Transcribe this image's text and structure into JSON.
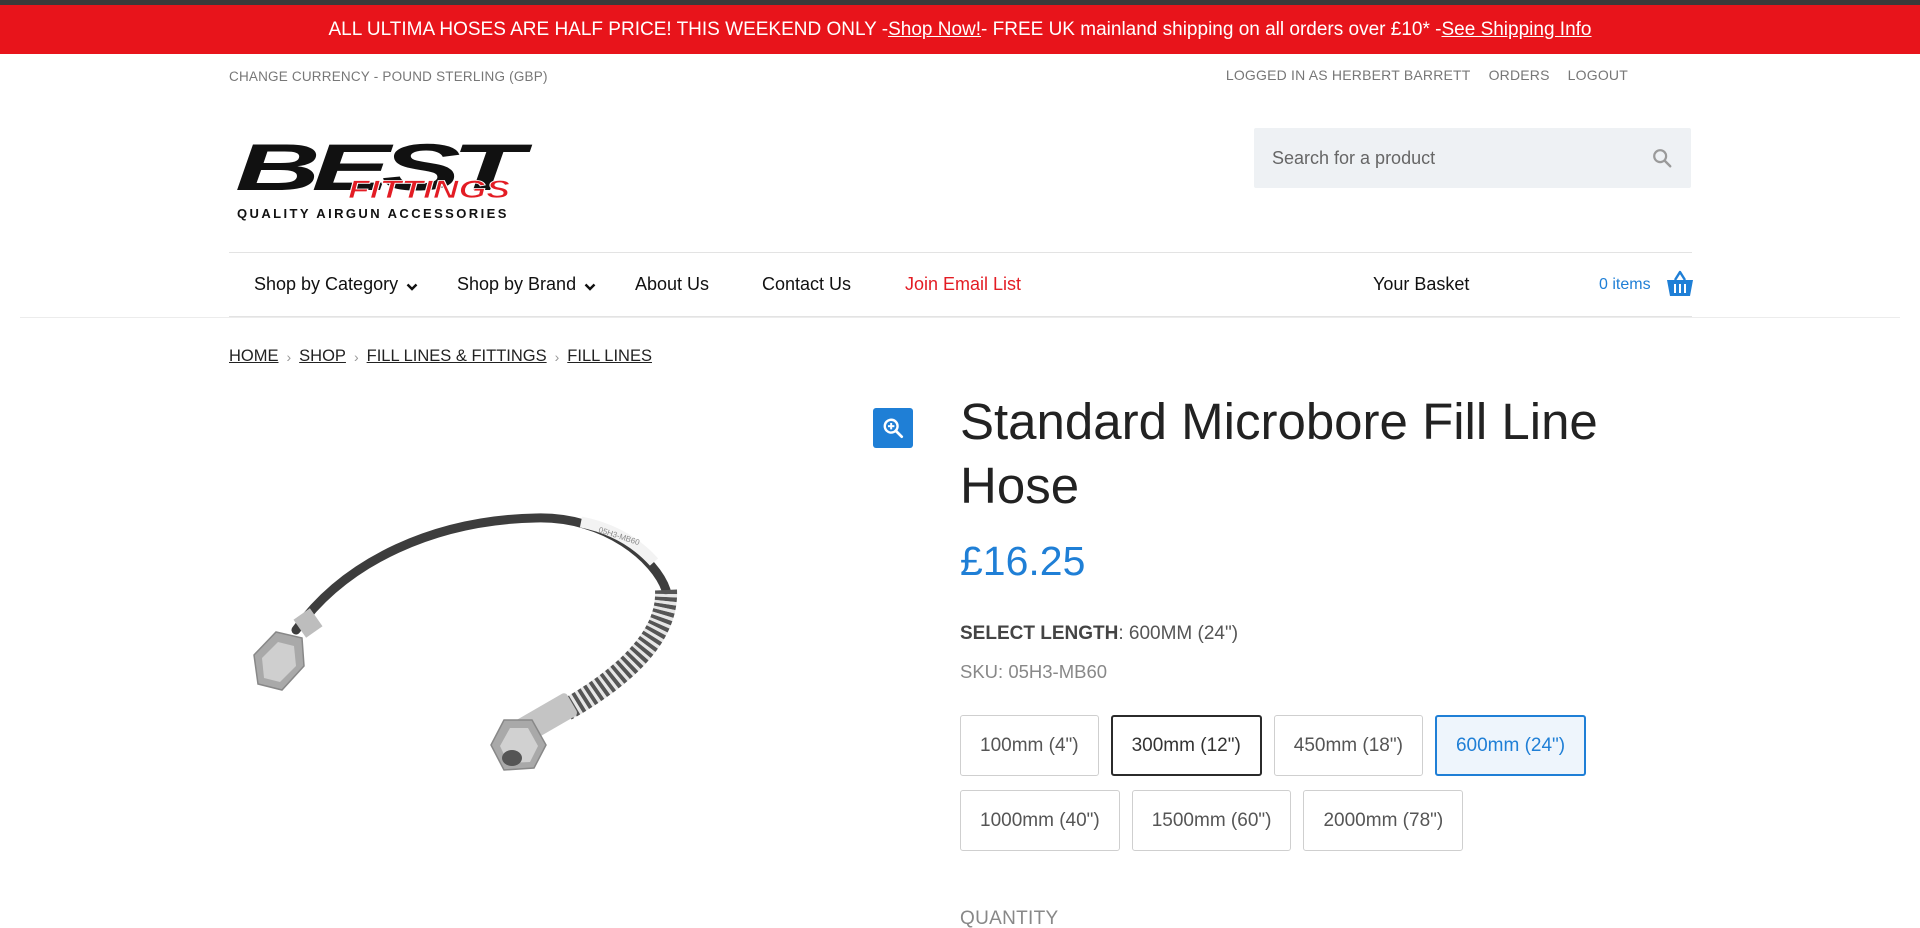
{
  "promo": {
    "text_1": "ALL ULTIMA HOSES ARE HALF PRICE! THIS WEEKEND ONLY - ",
    "link_1": "Shop Now!",
    "text_2": " - FREE UK mainland shipping on all orders over £10* - ",
    "link_2": "See Shipping Info",
    "bg_color": "#e8141b"
  },
  "utility": {
    "currency": "CHANGE CURRENCY - POUND STERLING (GBP)",
    "logged_in": "LOGGED IN AS HERBERT BARRETT",
    "orders": "ORDERS",
    "logout": "LOGOUT"
  },
  "logo": {
    "word_top": "BEST",
    "word_mid": "FITTINGS",
    "tagline": "QUALITY AIRGUN ACCESSORIES"
  },
  "search": {
    "placeholder": "Search for a product",
    "icon": "search-icon"
  },
  "nav": {
    "items": [
      {
        "label": "Shop by Category",
        "has_dropdown": true
      },
      {
        "label": "Shop by Brand",
        "has_dropdown": true
      },
      {
        "label": "About Us",
        "has_dropdown": false
      },
      {
        "label": "Contact Us",
        "has_dropdown": false
      },
      {
        "label": "Join Email List",
        "has_dropdown": false,
        "color": "#e31c24"
      }
    ],
    "basket_label": "Your Basket",
    "basket_count": "0 items",
    "basket_icon": "basket-icon"
  },
  "breadcrumbs": [
    "HOME",
    "SHOP",
    "FILL LINES & FITTINGS",
    "FILL LINES"
  ],
  "product": {
    "title": "Standard Microbore Fill Line Hose",
    "price": "£16.25",
    "select_length_label": "SELECT LENGTH",
    "select_length_value": ": 600MM (24\")",
    "sku": "SKU: 05H3-MB60",
    "hose_label": "05H3-MB60",
    "options": [
      "100mm (4\")",
      "300mm (12\")",
      "450mm (18\")",
      "600mm (24\")",
      "1000mm (40\")",
      "1500mm (60\")",
      "2000mm (78\")"
    ],
    "selected_option": "600mm (24\")",
    "hovered_option": "300mm (12\")",
    "quantity_label": "QUANTITY",
    "accent_color": "#1f7fd6"
  }
}
